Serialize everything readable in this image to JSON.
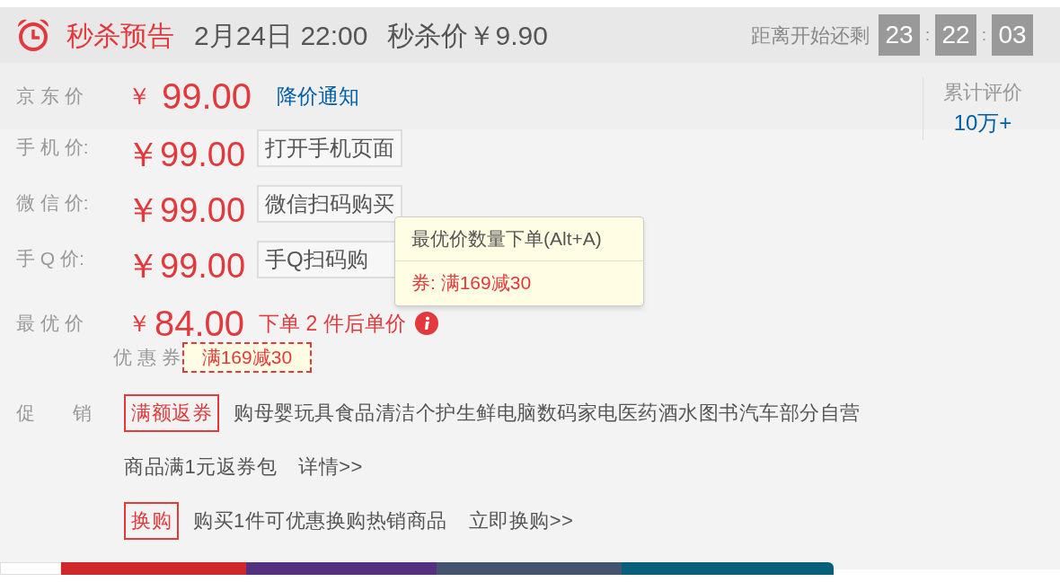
{
  "banner": {
    "title": "秒杀预告",
    "date": "2月24日 22:00",
    "seckill_price": "秒杀价￥9.90",
    "countdown_label": "距离开始还剩",
    "countdown": [
      "23",
      "22",
      "03"
    ],
    "separator": ":"
  },
  "jd_price": {
    "label": "京 东 价",
    "currency": "￥",
    "amount": "99.00",
    "link": "降价通知"
  },
  "reviews": {
    "label": "累计评价",
    "count": "10万+"
  },
  "channel_prices": [
    {
      "label": "手 机 价:",
      "price": "￥99.00",
      "button": "打开手机页面"
    },
    {
      "label": "微 信 价:",
      "price": "￥99.00",
      "button": "微信扫码购买"
    },
    {
      "label": "手 Q 价:",
      "price": "￥99.00",
      "button": "手Q扫码购"
    }
  ],
  "tooltip": {
    "title": "最优价数量下单(Alt+A)",
    "coupon": "券: 满169减30"
  },
  "best_price": {
    "label": "最 优 价",
    "currency": "￥",
    "amount": "84.00",
    "note": "下单 2 件后单价"
  },
  "coupon": {
    "label": "优 惠 券",
    "value": "满169减30"
  },
  "promotions": {
    "label": "促　　销",
    "items": [
      {
        "tag": "满额返券",
        "text": "购母婴玩具食品清洁个护生鲜电脑数码家电医药酒水图书汽车部分自营商品满1元返券包",
        "link": "详情>>"
      },
      {
        "tag": "换购",
        "text": "购买1件可优惠换购热销商品",
        "link": "立即换购>>"
      }
    ]
  },
  "bottom_tabs": [
    {
      "color": "#ffffff"
    },
    {
      "color": "#d0282a"
    },
    {
      "color": "#54307e"
    },
    {
      "color": "#44546e"
    },
    {
      "color": "#06607a"
    }
  ]
}
